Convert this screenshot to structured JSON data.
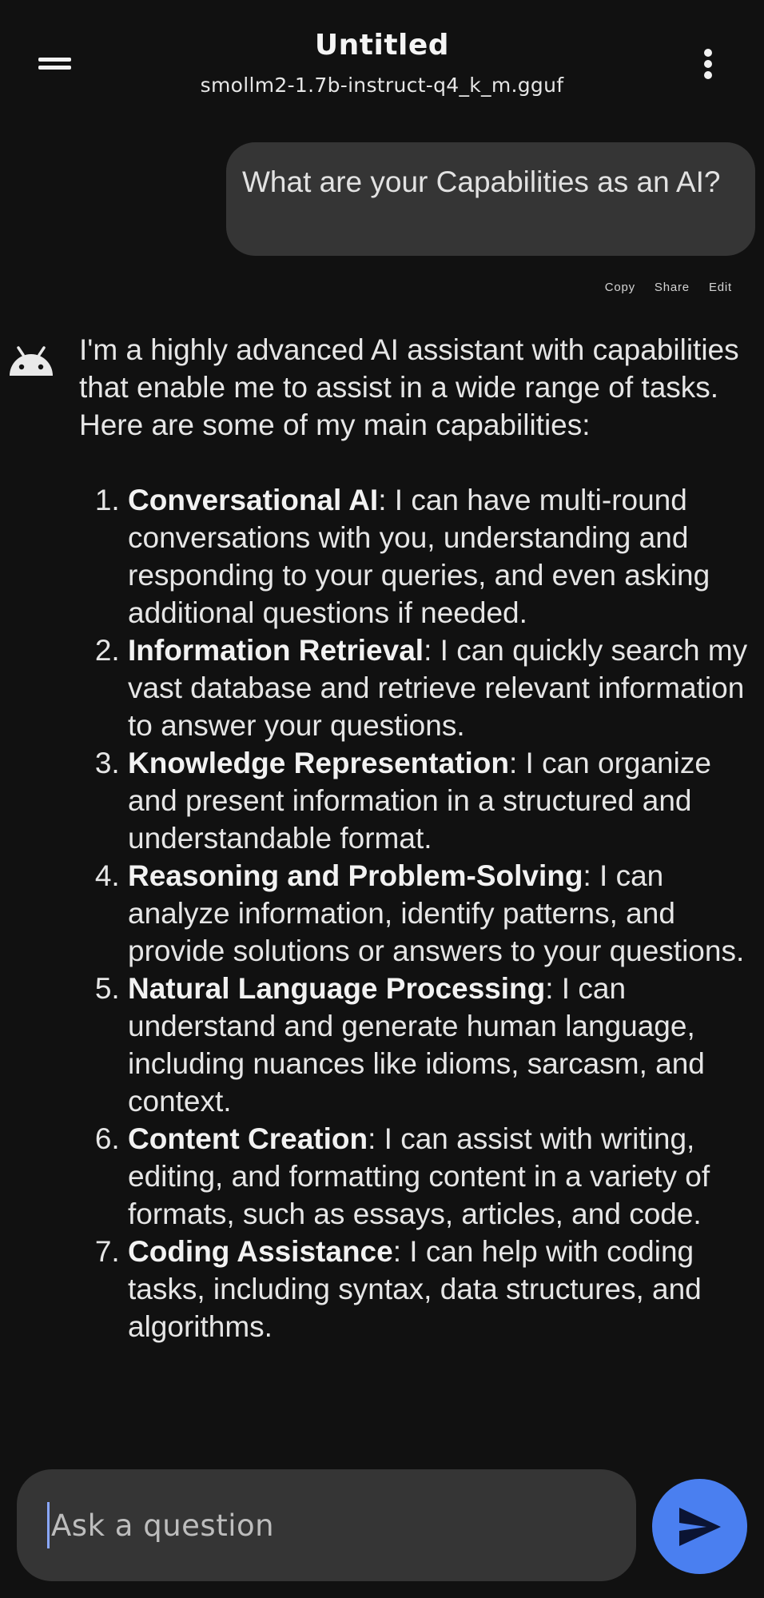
{
  "header": {
    "title": "Untitled",
    "model": "smollm2-1.7b-instruct-q4_k_m.gguf",
    "menu_icon": "hamburger-menu-icon",
    "more_icon": "more-vertical-icon"
  },
  "conversation": {
    "user_message": "What are your Capabilities as an AI?",
    "actions": {
      "copy": "Copy",
      "share": "Share",
      "edit": "Edit"
    },
    "assistant": {
      "avatar_icon": "android-icon",
      "intro": "I'm a highly advanced AI assistant with capabilities that enable me to assist in a wide range of tasks. Here are some of my main capabilities:",
      "items": [
        {
          "title": "Conversational AI",
          "text": ": I can have multi-round conversations with you, understanding and responding to your queries, and even asking additional questions if needed."
        },
        {
          "title": "Information Retrieval",
          "text": ": I can quickly search my vast database and retrieve relevant information to answer your questions."
        },
        {
          "title": "Knowledge Representation",
          "text": ": I can organize and present information in a structured and understandable format."
        },
        {
          "title": "Reasoning and Problem-Solving",
          "text": ": I can analyze information, identify patterns, and provide solutions or answers to your questions."
        },
        {
          "title": "Natural Language Processing",
          "text": ": I can understand and generate human language, including nuances like idioms, sarcasm, and context."
        },
        {
          "title": "Content Creation",
          "text": ": I can assist with writing, editing, and formatting content in a variety of formats, such as essays, articles, and code."
        },
        {
          "title": "Coding Assistance",
          "text": ": I can help with coding tasks, including syntax, data structures, and algorithms."
        }
      ]
    }
  },
  "composer": {
    "placeholder": "Ask a question",
    "value": "",
    "send_icon": "send-icon"
  },
  "colors": {
    "background": "#111111",
    "bubble": "#353535",
    "accent": "#4a7ff0"
  }
}
